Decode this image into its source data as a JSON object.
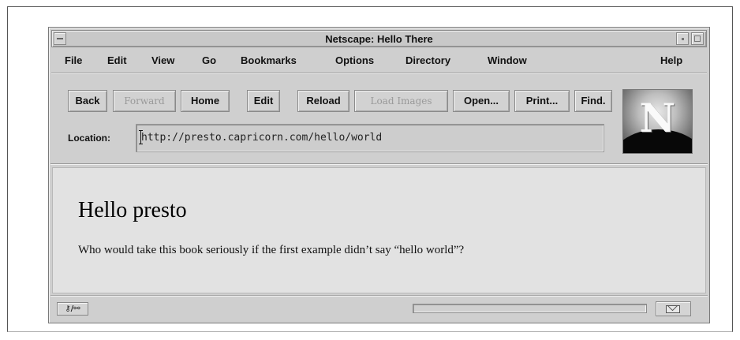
{
  "window": {
    "title": "Netscape: Hello There"
  },
  "menubar": {
    "items": [
      "File",
      "Edit",
      "View",
      "Go",
      "Bookmarks",
      "Options",
      "Directory",
      "Window",
      "Help"
    ]
  },
  "toolbar": {
    "back": "Back",
    "forward": "Forward",
    "home": "Home",
    "edit": "Edit",
    "reload": "Reload",
    "load_images": "Load Images",
    "open": "Open...",
    "print": "Print...",
    "find": "Find.",
    "disabled_color": "#9a9a9a"
  },
  "location": {
    "label": "Location:",
    "url": "http://presto.capricorn.com/hello/world"
  },
  "logo": {
    "icon": "netscape-n-logo-icon",
    "letter": "N"
  },
  "content": {
    "heading": "Hello presto",
    "paragraph": "Who would take this book seriously if the first example didn’t say “hello world”?"
  },
  "statusbar": {
    "security_icon": "security-key-icon",
    "security_glyph": "⚷/⚯",
    "progress": 0,
    "mail_icon": "mail-envelope-icon"
  }
}
